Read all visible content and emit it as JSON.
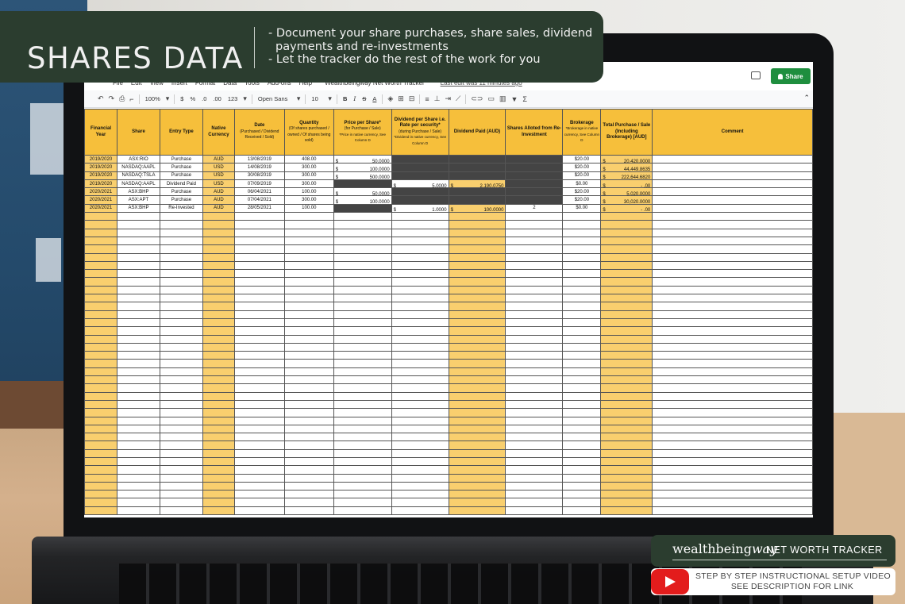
{
  "banner": {
    "title": "SHARES DATA",
    "bullets": [
      "- Document your share purchases, share sales, dividend",
      "  payments and re-investments",
      "- Let the tracker do the rest of the work for you"
    ]
  },
  "menubar": {
    "items": [
      "File",
      "Edit",
      "View",
      "Insert",
      "Format",
      "Data",
      "Tools",
      "Add-ons",
      "Help"
    ],
    "doc_title": "Wealthbeingway Net Worth Tracker",
    "last_edit": "Last edit was 11 minutes ago",
    "share_label": "Share"
  },
  "toolbar": {
    "zoom": "100%",
    "currency": "$",
    "percent": "%",
    "dec_less": ".0",
    "dec_more": ".00",
    "format": "123",
    "font": "Open Sans",
    "size": "10",
    "bold": "B",
    "italic": "I",
    "strike": "S",
    "textcolor": "A"
  },
  "sheet": {
    "headers": {
      "fy": "Financial Year",
      "share": "Share",
      "entry": "Entry Type",
      "currency": "Native Currency",
      "date": "Date",
      "date_sub": "(Purchased / Dividend Received / Sold)",
      "qty": "Quantity",
      "qty_sub": "(Of shares purchased / owned / Of shares being sold)",
      "price": "Price per Share*",
      "price_sub": "(for Purchase / Sale)",
      "price_note": "*Price in native currency, See Column D",
      "dps": "Dividend per Share i.e. Rate per security*",
      "dps_sub": "(during Purchase / Sale)",
      "dps_note": "*Dividend in native currency, See Column D",
      "divpaid": "Dividend Paid (AUD)",
      "allot": "Shares Alloted from Re-Investment",
      "brokerage": "Brokerage",
      "brokerage_note": "*Brokerage in native currency, See Column D",
      "total": "Total Purchase / Sale (Including Brokerage) [AUD]",
      "comment": "Comment"
    },
    "rows": [
      {
        "fy": "2019/2020",
        "share": "ASX:RIO",
        "entry": "Purchase",
        "cur": "AUD",
        "date": "13/08/2019",
        "qty": "408.00",
        "price": "50.0000",
        "dps": "",
        "divpaid": "",
        "allot": "",
        "brokerage": "$20.00",
        "total": "20,420.0000"
      },
      {
        "fy": "2019/2020",
        "share": "NASDAQ:AAPL",
        "entry": "Purchase",
        "cur": "USD",
        "date": "14/08/2019",
        "qty": "300.00",
        "price": "100.0000",
        "dps": "",
        "divpaid": "",
        "allot": "",
        "brokerage": "$20.00",
        "total": "44,449.8635"
      },
      {
        "fy": "2019/2020",
        "share": "NASDAQ:TSLA",
        "entry": "Purchase",
        "cur": "USD",
        "date": "30/08/2019",
        "qty": "300.00",
        "price": "500.0000",
        "dps": "",
        "divpaid": "",
        "allot": "",
        "brokerage": "$20.00",
        "total": "222,644.6820"
      },
      {
        "fy": "2019/2020",
        "share": "NASDAQ:AAPL",
        "entry": "Dividend Paid",
        "cur": "USD",
        "date": "07/09/2019",
        "qty": "300.00",
        "price": "",
        "dps": "5.0000",
        "divpaid": "2,190.0750",
        "allot": "",
        "brokerage": "$0.00",
        "total": "-   .00"
      },
      {
        "fy": "2020/2021",
        "share": "ASX:BHP",
        "entry": "Purchase",
        "cur": "AUD",
        "date": "06/04/2021",
        "qty": "100.00",
        "price": "50.0000",
        "dps": "",
        "divpaid": "",
        "allot": "",
        "brokerage": "$20.00",
        "total": "5,020.0000"
      },
      {
        "fy": "2020/2021",
        "share": "ASX:APT",
        "entry": "Purchase",
        "cur": "AUD",
        "date": "07/04/2021",
        "qty": "300.00",
        "price": "100.0000",
        "dps": "",
        "divpaid": "",
        "allot": "",
        "brokerage": "$20.00",
        "total": "30,020.0000"
      },
      {
        "fy": "2020/2021",
        "share": "ASX:BHP",
        "entry": "Re-Invested",
        "cur": "AUD",
        "date": "28/05/2021",
        "qty": "100.00",
        "price": "",
        "dps": "1.0000",
        "divpaid": "100.0000",
        "allot": "2",
        "brokerage": "$0.00",
        "total": "-   .00"
      }
    ],
    "dollar": "$"
  },
  "brand": {
    "logo_main": "wealthbeing",
    "logo_italic": "way",
    "logo_sub": "NET WORTH TRACKER"
  },
  "video": {
    "line1": "STEP BY STEP INSTRUCTIONAL SETUP VIDEO",
    "line2": "SEE DESCRIPTION FOR LINK"
  },
  "colors": {
    "header_yellow": "#f6bf3b",
    "column_yellow": "#f9cf6e",
    "banner_green": "#2b3d2f",
    "share_green": "#1e8e3e",
    "youtube_red": "#e31c1c"
  }
}
